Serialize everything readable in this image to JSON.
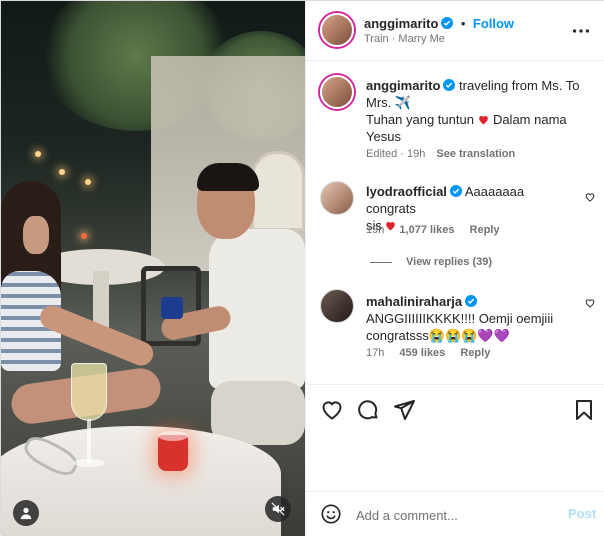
{
  "header": {
    "username": "anggimarito",
    "follow_label": "Follow",
    "subtitle": "Train · Marry Me",
    "more_icon": "more-horizontal-icon"
  },
  "caption": {
    "username": "anggimarito",
    "line1": "traveling from Ms. To",
    "line2": "Mrs. ✈️",
    "line3": "Tuhan yang tuntun",
    "line3b": "Dalam nama",
    "line4": "Yesus",
    "meta": "Edited · 19h",
    "see_translation": "See translation"
  },
  "comments": [
    {
      "username": "lyodraofficial",
      "text_line1": "Aaaaaaaa congrats",
      "text_line2": "sis",
      "time": "19h",
      "likes": "1,077 likes",
      "reply": "Reply",
      "view_replies": "View replies (39)"
    },
    {
      "username": "mahaliniraharja",
      "text_line1": "ANGGIIIIIIKKKK!!!! Oemji oemjiii",
      "text_line2": "congratsss😭😭😭💜💜",
      "time": "17h",
      "likes": "459 likes",
      "reply": "Reply"
    }
  ],
  "add_comment": {
    "placeholder": "Add a comment...",
    "post_label": "Post"
  },
  "colors": {
    "accent": "#0095f6",
    "verified": "#0095f6",
    "heart": "#e0242f",
    "post_disabled": "#b2dffc"
  }
}
